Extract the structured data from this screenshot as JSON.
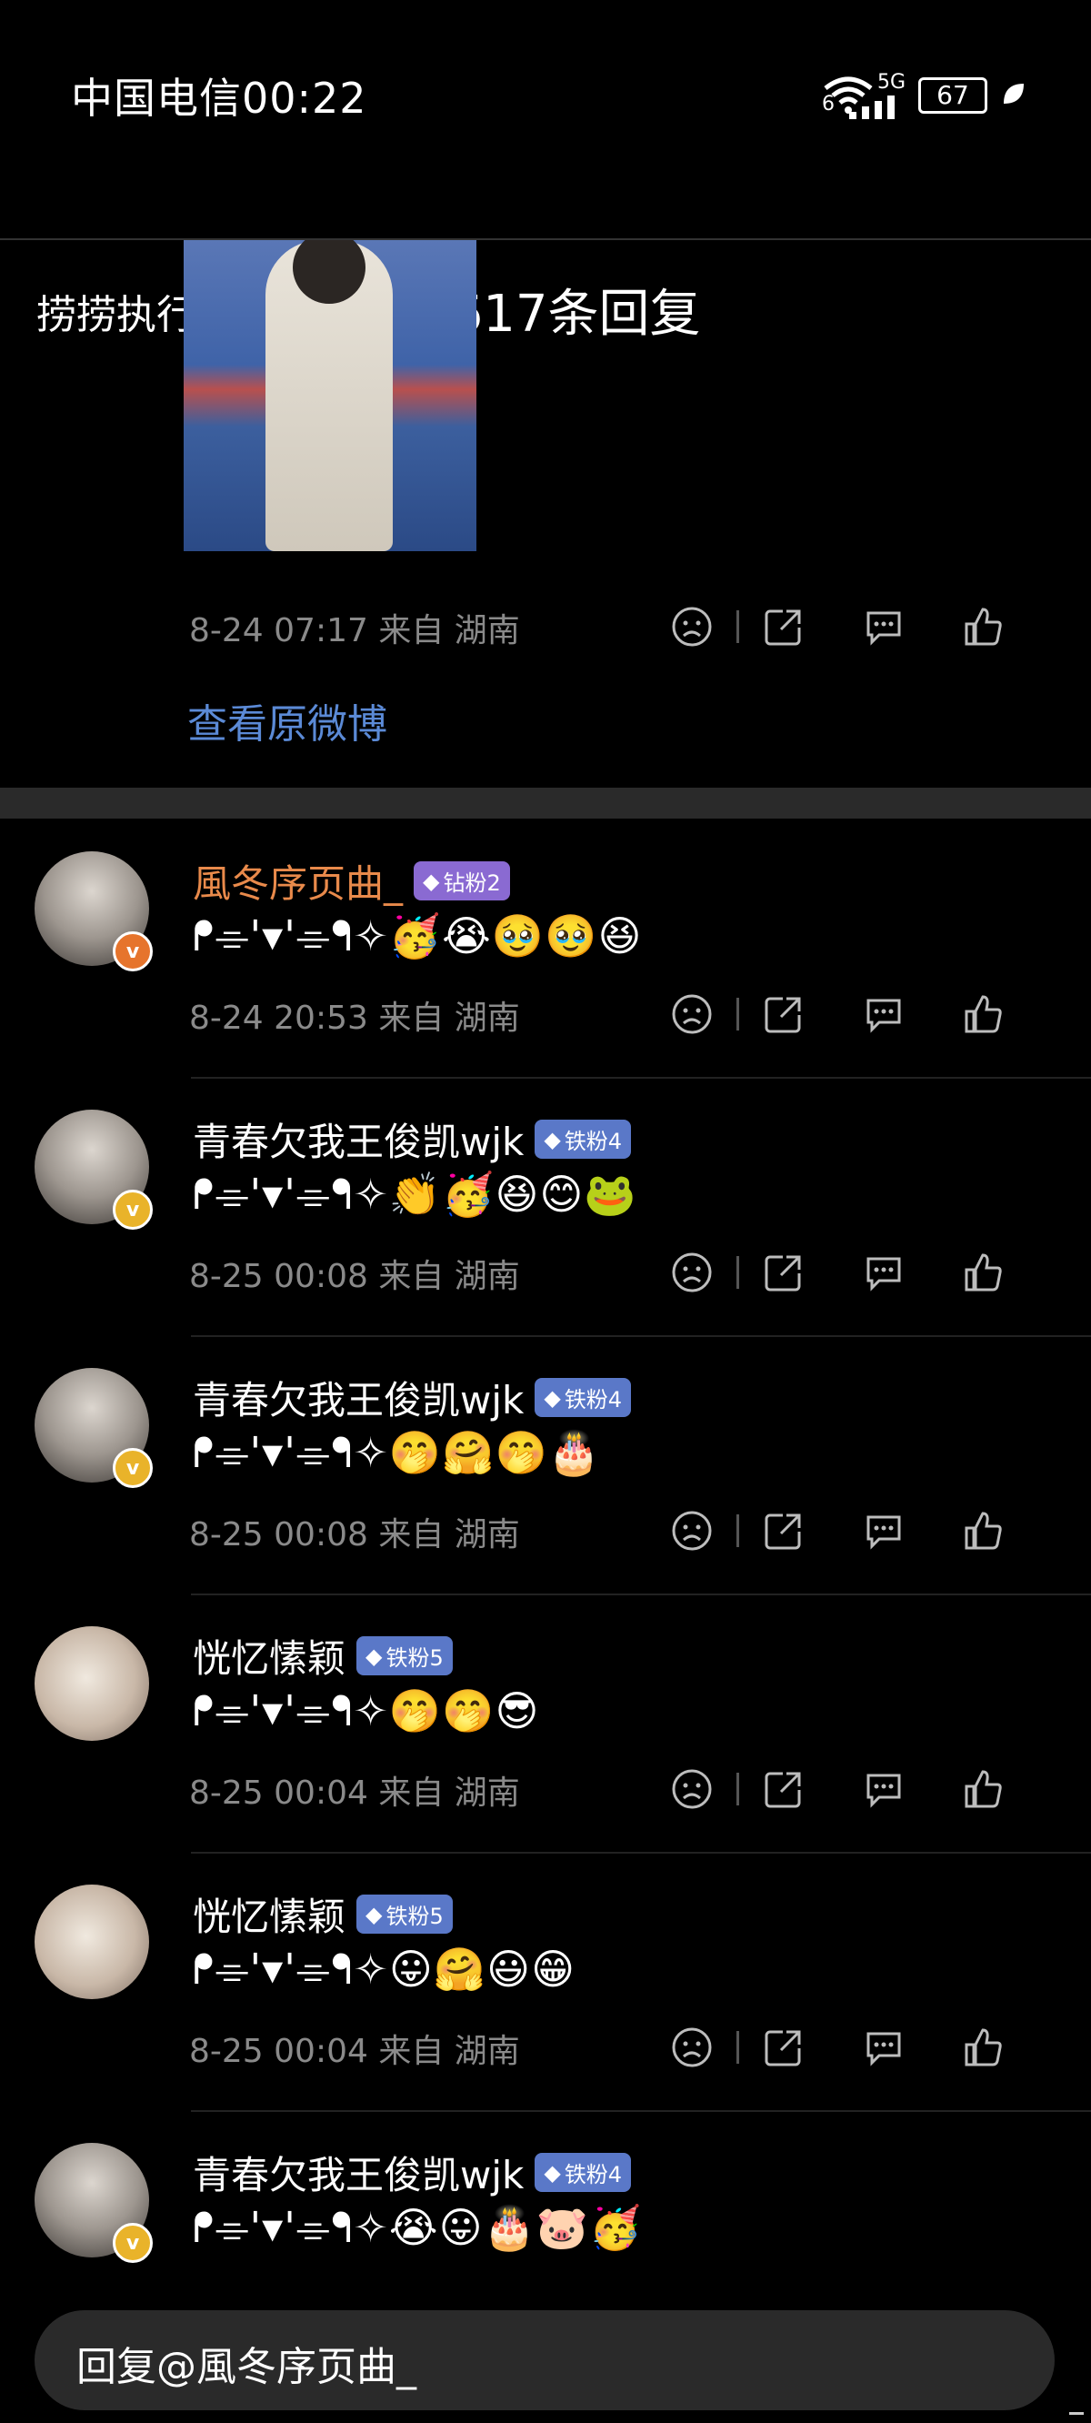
{
  "status_bar": {
    "carrier": "中国电信",
    "time": "00:22",
    "wifi": "6",
    "network": "5G",
    "battery": "67"
  },
  "nav": {
    "back_label": "捞捞执行中",
    "title": "2617条回复"
  },
  "post": {
    "meta": "8-24 07:17 来自 湖南",
    "view_original": "查看原微博"
  },
  "icons": {
    "dislike": "dislike-face-icon",
    "share": "share-icon",
    "comment": "comment-icon",
    "like": "thumbs-up-icon"
  },
  "comments": [
    {
      "username": "風冬序页曲_",
      "badge": "钻粉2",
      "badge_color": "#8a6ad2",
      "name_color": "#e98a4b",
      "verified_color": "#e6742c",
      "text": "ᖰ⌯'▾'⌯ᖳ✧🥳😭🥹🥹😆",
      "meta": "8-24 20:53 来自 湖南"
    },
    {
      "username": "青春欠我王俊凯wjk",
      "badge": "铁粉4",
      "badge_color": "#5a78c8",
      "name_color": "#ffffff",
      "verified_color": "#e9b32a",
      "text": "ᖰ⌯'▾'⌯ᖳ✧👏🥳😆😊🐸",
      "meta": "8-25 00:08 来自 湖南"
    },
    {
      "username": "青春欠我王俊凯wjk",
      "badge": "铁粉4",
      "badge_color": "#5a78c8",
      "name_color": "#ffffff",
      "verified_color": "#e9b32a",
      "text": "ᖰ⌯'▾'⌯ᖳ✧🤭🤗🤭🎂",
      "meta": "8-25 00:08 来自 湖南"
    },
    {
      "username": "恍忆愫颖",
      "badge": "铁粉5",
      "badge_color": "#5a78c8",
      "name_color": "#ffffff",
      "verified_color": "",
      "text": "ᖰ⌯'▾'⌯ᖳ✧🤭🤭😎",
      "meta": "8-25 00:04 来自 湖南"
    },
    {
      "username": "恍忆愫颖",
      "badge": "铁粉5",
      "badge_color": "#5a78c8",
      "name_color": "#ffffff",
      "verified_color": "",
      "text": "ᖰ⌯'▾'⌯ᖳ✧😛🤗😃😁",
      "meta": "8-25 00:04 来自 湖南"
    },
    {
      "username": "青春欠我王俊凯wjk",
      "badge": "铁粉4",
      "badge_color": "#5a78c8",
      "name_color": "#ffffff",
      "verified_color": "#e9b32a",
      "text": "ᖰ⌯'▾'⌯ᖳ✧😭😛🎂🐷🥳",
      "meta": ""
    }
  ],
  "reply_input": {
    "placeholder": "回复@風冬序页曲_"
  }
}
